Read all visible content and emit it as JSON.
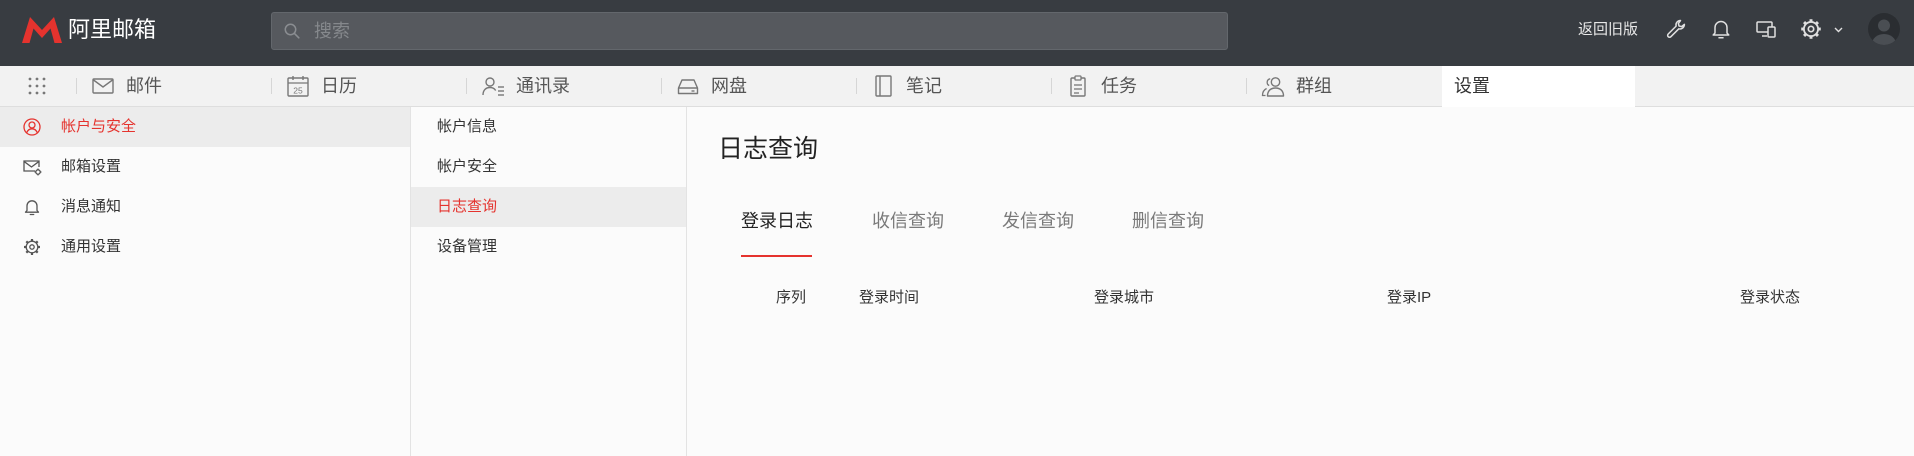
{
  "app": {
    "logo_text": "阿里邮箱"
  },
  "topbar": {
    "search_placeholder": "搜索",
    "back_to_old_label": "返回旧版",
    "icons": [
      "wrench-icon",
      "bell-icon",
      "devices-icon",
      "gear-icon",
      "chevron-down-icon",
      "avatar"
    ]
  },
  "nav": {
    "tabs": [
      {
        "label": "邮件",
        "icon": "mail-icon"
      },
      {
        "label": "日历",
        "icon": "calendar-icon",
        "icon_text": "25"
      },
      {
        "label": "通讯录",
        "icon": "contacts-icon"
      },
      {
        "label": "网盘",
        "icon": "drive-icon"
      },
      {
        "label": "笔记",
        "icon": "notebook-icon"
      },
      {
        "label": "任务",
        "icon": "tasks-icon"
      },
      {
        "label": "群组",
        "icon": "group-icon"
      },
      {
        "label": "设置",
        "active": true
      }
    ]
  },
  "sidebar": {
    "items": [
      {
        "label": "帐户与安全",
        "icon": "user-circle-icon",
        "active": true
      },
      {
        "label": "邮箱设置",
        "icon": "mail-settings-icon"
      },
      {
        "label": "消息通知",
        "icon": "bell-icon"
      },
      {
        "label": "通用设置",
        "icon": "gear-icon"
      }
    ]
  },
  "submenu": {
    "items": [
      {
        "label": "帐户信息"
      },
      {
        "label": "帐户安全"
      },
      {
        "label": "日志查询",
        "active": true
      },
      {
        "label": "设备管理"
      }
    ]
  },
  "content": {
    "title": "日志查询",
    "tabs": [
      {
        "label": "登录日志",
        "active": true
      },
      {
        "label": "收信查询"
      },
      {
        "label": "发信查询"
      },
      {
        "label": "删信查询"
      }
    ],
    "table": {
      "columns": [
        "序列",
        "登录时间",
        "登录城市",
        "登录IP",
        "登录状态"
      ],
      "rows": []
    }
  },
  "colors": {
    "accent": "#e5332e",
    "topbar": "#383c41",
    "tabbar": "#f2f2f2",
    "active_item_bg": "#ececec",
    "page_bg": "#fbfbfb"
  }
}
